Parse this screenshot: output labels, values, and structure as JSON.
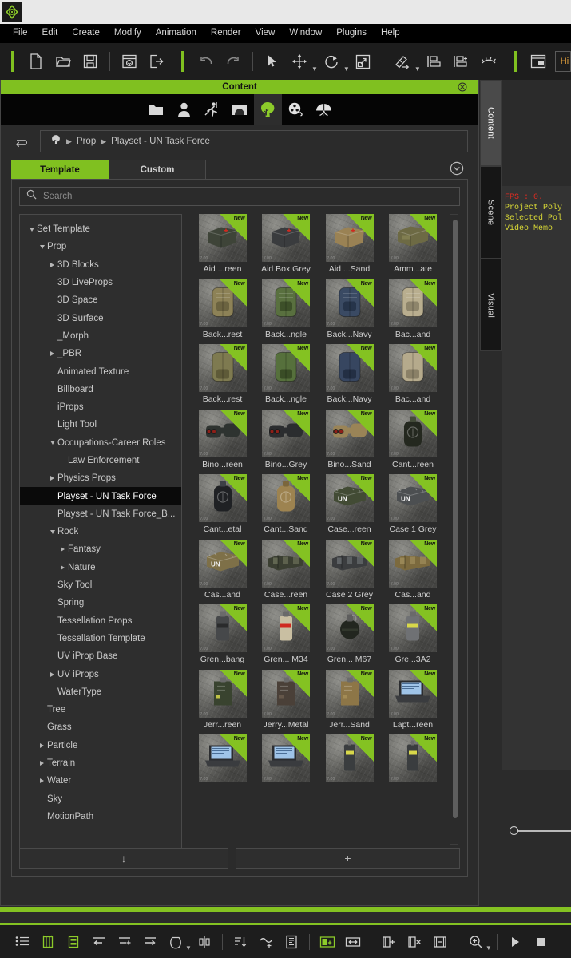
{
  "app": {
    "logo_icon": "app-logo-icon"
  },
  "menubar": {
    "items": [
      {
        "label": "File"
      },
      {
        "label": "Edit"
      },
      {
        "label": "Create"
      },
      {
        "label": "Modify"
      },
      {
        "label": "Animation"
      },
      {
        "label": "Render"
      },
      {
        "label": "View"
      },
      {
        "label": "Window"
      },
      {
        "label": "Plugins"
      },
      {
        "label": "Help"
      }
    ]
  },
  "toolbar": {
    "accent_color": "#80c020",
    "buttons": [
      {
        "name": "new-project-icon",
        "title": "New"
      },
      {
        "name": "open-project-icon",
        "title": "Open"
      },
      {
        "name": "save-project-icon",
        "title": "Save"
      },
      {
        "name": "import-icon",
        "title": "Import"
      },
      {
        "name": "export-icon",
        "title": "Export"
      },
      {
        "name": "undo-icon",
        "title": "Undo"
      },
      {
        "name": "redo-icon",
        "title": "Redo"
      },
      {
        "name": "select-tool-icon",
        "title": "Select"
      },
      {
        "name": "move-tool-icon",
        "title": "Move"
      },
      {
        "name": "rotate-tool-icon",
        "title": "Rotate"
      },
      {
        "name": "scale-tool-icon",
        "title": "Scale"
      },
      {
        "name": "edit-pivot-icon",
        "title": "Edit Pivot"
      },
      {
        "name": "align-bottom-icon",
        "title": "Align"
      },
      {
        "name": "align-add-icon",
        "title": "Align Add"
      },
      {
        "name": "eyelash-icon",
        "title": "Hide"
      },
      {
        "name": "layout-panel-icon",
        "title": "Layout"
      }
    ],
    "field_value": "Hi"
  },
  "content_panel": {
    "title": "Content",
    "close_icon": "close-icon",
    "icon_tabs": [
      {
        "name": "folder-icon",
        "label": "Folder",
        "active": false
      },
      {
        "name": "actor-icon",
        "label": "Actor",
        "active": false
      },
      {
        "name": "motion-icon",
        "label": "Motion",
        "active": false
      },
      {
        "name": "stage-icon",
        "label": "Stage",
        "active": false
      },
      {
        "name": "prop-tree-icon",
        "label": "Prop",
        "active": true
      },
      {
        "name": "media-reel-icon",
        "label": "Media",
        "active": false
      },
      {
        "name": "particle-icon",
        "label": "Particle",
        "active": false
      }
    ],
    "back_icon": "back-arrow-icon",
    "breadcrumb": {
      "root_icon": "tree-root-icon",
      "segments": [
        "Prop",
        "Playset - UN Task Force"
      ]
    },
    "tabs": [
      {
        "label": "Template",
        "active": true
      },
      {
        "label": "Custom",
        "active": false
      }
    ],
    "collapse_icon": "chevron-down-circle-icon",
    "search": {
      "placeholder": "Search",
      "value": "",
      "icon": "search-icon"
    },
    "tree": [
      {
        "label": "Set Template",
        "depth": 0,
        "twisty": "down"
      },
      {
        "label": "Prop",
        "depth": 1,
        "twisty": "down"
      },
      {
        "label": "3D Blocks",
        "depth": 2,
        "twisty": "right"
      },
      {
        "label": "3D LiveProps",
        "depth": 2,
        "twisty": "none"
      },
      {
        "label": "3D Space",
        "depth": 2,
        "twisty": "none"
      },
      {
        "label": "3D Surface",
        "depth": 2,
        "twisty": "none"
      },
      {
        "label": "_Morph",
        "depth": 2,
        "twisty": "none"
      },
      {
        "label": "_PBR",
        "depth": 2,
        "twisty": "right"
      },
      {
        "label": "Animated Texture",
        "depth": 2,
        "twisty": "none"
      },
      {
        "label": "Billboard",
        "depth": 2,
        "twisty": "none"
      },
      {
        "label": "iProps",
        "depth": 2,
        "twisty": "none"
      },
      {
        "label": "Light Tool",
        "depth": 2,
        "twisty": "none"
      },
      {
        "label": "Occupations-Career Roles",
        "depth": 2,
        "twisty": "down"
      },
      {
        "label": "Law Enforcement",
        "depth": 3,
        "twisty": "none"
      },
      {
        "label": "Physics Props",
        "depth": 2,
        "twisty": "right"
      },
      {
        "label": "Playset - UN Task Force",
        "depth": 2,
        "twisty": "none",
        "selected": true
      },
      {
        "label": "Playset - UN Task Force_B...",
        "depth": 2,
        "twisty": "none"
      },
      {
        "label": "Rock",
        "depth": 2,
        "twisty": "down"
      },
      {
        "label": "Fantasy",
        "depth": 3,
        "twisty": "right"
      },
      {
        "label": "Nature",
        "depth": 3,
        "twisty": "right"
      },
      {
        "label": "Sky Tool",
        "depth": 2,
        "twisty": "none"
      },
      {
        "label": "Spring",
        "depth": 2,
        "twisty": "none"
      },
      {
        "label": "Tessellation Props",
        "depth": 2,
        "twisty": "none"
      },
      {
        "label": "Tessellation Template",
        "depth": 2,
        "twisty": "none"
      },
      {
        "label": "UV iProp Base",
        "depth": 2,
        "twisty": "none"
      },
      {
        "label": "UV iProps",
        "depth": 2,
        "twisty": "right"
      },
      {
        "label": "WaterType",
        "depth": 2,
        "twisty": "none"
      },
      {
        "label": "Tree",
        "depth": 1,
        "twisty": "none"
      },
      {
        "label": "Grass",
        "depth": 1,
        "twisty": "none"
      },
      {
        "label": "Particle",
        "depth": 1,
        "twisty": "right"
      },
      {
        "label": "Terrain",
        "depth": 1,
        "twisty": "right"
      },
      {
        "label": "Water",
        "depth": 1,
        "twisty": "right"
      },
      {
        "label": "Sky",
        "depth": 1,
        "twisty": "none"
      },
      {
        "label": "MotionPath",
        "depth": 1,
        "twisty": "none"
      }
    ],
    "badge_label": "New",
    "thumb_watermark": "7.00",
    "assets": [
      {
        "caption": "Aid ...reen",
        "kind": "box",
        "color": "#3e4438",
        "accent": "#cf2a20"
      },
      {
        "caption": "Aid Box Grey",
        "kind": "box",
        "color": "#3a3c3e",
        "accent": "#cf2a20"
      },
      {
        "caption": "Aid ...Sand",
        "kind": "box",
        "color": "#9a8254",
        "accent": "#cf2a20"
      },
      {
        "caption": "Amm...ate",
        "kind": "crate",
        "color": "#6d6a44",
        "accent": "#8a8757"
      },
      {
        "caption": "Back...rest",
        "kind": "pack",
        "color": "#8d8257",
        "accent": "#6b6340"
      },
      {
        "caption": "Back...ngle",
        "kind": "pack",
        "color": "#59703f",
        "accent": "#3d5029"
      },
      {
        "caption": "Back...Navy",
        "kind": "pack",
        "color": "#3a4a63",
        "accent": "#26344a"
      },
      {
        "caption": "Bac...and",
        "kind": "pack",
        "color": "#b9ae8f",
        "accent": "#8e856b"
      },
      {
        "caption": "Back...rest",
        "kind": "pack2",
        "color": "#7e7a50",
        "accent": "#5e5a38"
      },
      {
        "caption": "Back...ngle",
        "kind": "pack2",
        "color": "#56703c",
        "accent": "#3a4d26"
      },
      {
        "caption": "Back...Navy",
        "kind": "pack2",
        "color": "#374660",
        "accent": "#232f44"
      },
      {
        "caption": "Bac...and",
        "kind": "pack2",
        "color": "#b5aa8c",
        "accent": "#8a8067"
      },
      {
        "caption": "Bino...reen",
        "kind": "binoc",
        "color": "#2e3330",
        "accent": "#8e1f18"
      },
      {
        "caption": "Bino...Grey",
        "kind": "binoc",
        "color": "#2b2d2f",
        "accent": "#8e1f18"
      },
      {
        "caption": "Bino...Sand",
        "kind": "binoc",
        "color": "#9a8457",
        "accent": "#8e1f18"
      },
      {
        "caption": "Cant...reen",
        "kind": "canteen",
        "color": "#24281f",
        "accent": "#434b39"
      },
      {
        "caption": "Cant...etal",
        "kind": "canteen",
        "color": "#1f2124",
        "accent": "#3c4046"
      },
      {
        "caption": "Cant...Sand",
        "kind": "canteen",
        "color": "#9d8350",
        "accent": "#7b663c"
      },
      {
        "caption": "Case...reen",
        "kind": "case",
        "color": "#424b34",
        "accent": "#eeeeee"
      },
      {
        "caption": "Case 1 Grey",
        "kind": "case",
        "color": "#4c4f51",
        "accent": "#eeeeee"
      },
      {
        "caption": "Cas...and",
        "kind": "case",
        "color": "#7e7048",
        "accent": "#eeeeee"
      },
      {
        "caption": "Case...reen",
        "kind": "case2",
        "color": "#3b3f32",
        "accent": "#6c7159"
      },
      {
        "caption": "Case 2 Grey",
        "kind": "case2",
        "color": "#3b3d3f",
        "accent": "#696d70"
      },
      {
        "caption": "Cas...and",
        "kind": "case2",
        "color": "#7c6a3e",
        "accent": "#a08e5c"
      },
      {
        "caption": "Gren...bang",
        "kind": "grenade-stick",
        "color": "#46484a",
        "accent": "#2a2b2c"
      },
      {
        "caption": "Gren... M34",
        "kind": "grenade-stick",
        "color": "#c9bfa2",
        "accent": "#cf2a20"
      },
      {
        "caption": "Gren... M67",
        "kind": "grenade-round",
        "color": "#22261f",
        "accent": "#3c4336"
      },
      {
        "caption": "Gre...3A2",
        "kind": "grenade-stick",
        "color": "#6f7174",
        "accent": "#d8d84a"
      },
      {
        "caption": "Jerr...reen",
        "kind": "jerry",
        "color": "#39432f",
        "accent": "#d8d84a"
      },
      {
        "caption": "Jerry...Metal",
        "kind": "jerry",
        "color": "#4a4038",
        "accent": "#6a5c4e"
      },
      {
        "caption": "Jerr...Sand",
        "kind": "jerry",
        "color": "#8d7647",
        "accent": "#a78f58"
      },
      {
        "caption": "Lapt...reen",
        "kind": "laptop",
        "color": "#2b2d30",
        "accent": "#9fc4e8"
      },
      {
        "caption": "",
        "kind": "laptop",
        "color": "#2b2d30",
        "accent": "#9fc4e8",
        "partial": true
      },
      {
        "caption": "",
        "kind": "laptop",
        "color": "#2b2d30",
        "accent": "#9fc4e8",
        "partial": true
      },
      {
        "caption": "",
        "kind": "radio",
        "color": "#2b2b2b",
        "accent": "#d8d84a",
        "partial": true
      },
      {
        "caption": "",
        "kind": "radio",
        "color": "#2b2b2b",
        "accent": "#d8d84a",
        "partial": true
      }
    ],
    "footer": {
      "download_label": "↓",
      "add_label": "+"
    }
  },
  "vertical_dock": {
    "tabs": [
      {
        "label": "Content",
        "active": true
      },
      {
        "label": "Scene",
        "active": false
      },
      {
        "label": "Visual",
        "active": false
      }
    ]
  },
  "viewport": {
    "stats": {
      "fps": "FPS : 0.",
      "project_poly": "Project Poly",
      "selected_poly": "Selected Pol",
      "video_memory": "Video Memo"
    }
  },
  "bottom_toolbar": {
    "buttons": [
      {
        "name": "track-list-icon"
      },
      {
        "name": "add-keyframe-icon"
      },
      {
        "name": "collect-clip-icon"
      },
      {
        "name": "move-left-icon"
      },
      {
        "name": "insert-frame-icon"
      },
      {
        "name": "move-right-icon"
      },
      {
        "name": "loop-icon"
      },
      {
        "name": "mirror-icon"
      },
      {
        "name": "sort-icon"
      },
      {
        "name": "transition-icon"
      },
      {
        "name": "clip-props-icon"
      },
      {
        "name": "split-green-icon"
      },
      {
        "name": "resize-clip-icon"
      },
      {
        "name": "add-track-icon"
      },
      {
        "name": "delete-track-icon"
      },
      {
        "name": "range-icon"
      },
      {
        "name": "zoom-icon"
      },
      {
        "name": "play-icon"
      },
      {
        "name": "stop-icon"
      }
    ]
  }
}
